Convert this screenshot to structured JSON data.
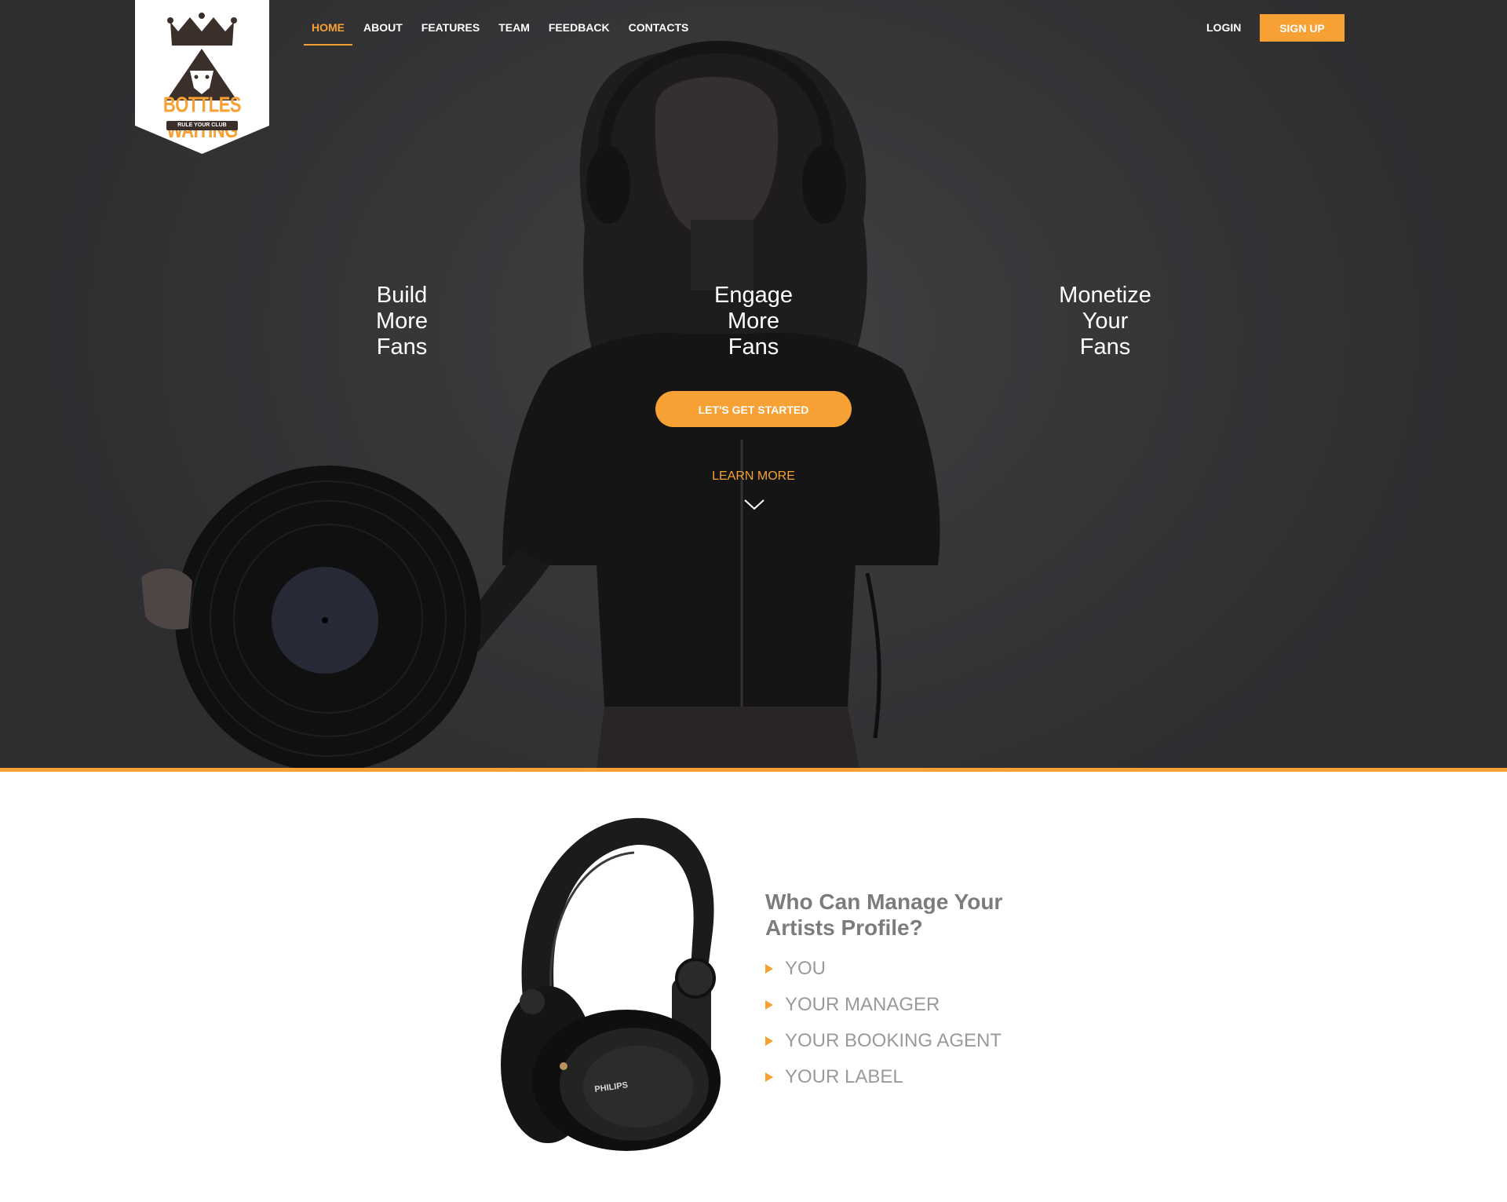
{
  "brand": {
    "name": "BOTTLES WAITING",
    "tagline": "RULE YOUR CLUB"
  },
  "nav": {
    "items": [
      {
        "label": "HOME",
        "active": true
      },
      {
        "label": "ABOUT",
        "active": false
      },
      {
        "label": "FEATURES",
        "active": false
      },
      {
        "label": "TEAM",
        "active": false
      },
      {
        "label": "FEEDBACK",
        "active": false
      },
      {
        "label": "CONTACTS",
        "active": false
      }
    ],
    "login_label": "LOGIN",
    "signup_label": "SIGN UP"
  },
  "hero": {
    "taglines": [
      {
        "l1": "Build",
        "l2": "More",
        "l3": "Fans"
      },
      {
        "l1": "Engage",
        "l2": "More",
        "l3": "Fans"
      },
      {
        "l1": "Monetize",
        "l2": "Your",
        "l3": "Fans"
      }
    ],
    "cta_label": "LET'S GET STARTED",
    "learn_more_label": "LEARN MORE"
  },
  "who": {
    "title_line1": "Who Can Manage Your",
    "title_line2": "Artists Profile?",
    "items": [
      "YOU",
      "YOUR MANAGER",
      "YOUR BOOKING AGENT",
      "YOUR LABEL"
    ],
    "product_brand": "PHILIPS"
  },
  "colors": {
    "accent": "#f7a034",
    "hero_bg": "#3e3e40",
    "logo_dark": "#3b2f2c",
    "who_title": "#7c7c7c",
    "who_item": "#9a9a9a"
  },
  "icons": {
    "logo": "crown-lion-logo",
    "learn_more": "chevron-down-icon",
    "bullet": "triangle-right-icon"
  }
}
